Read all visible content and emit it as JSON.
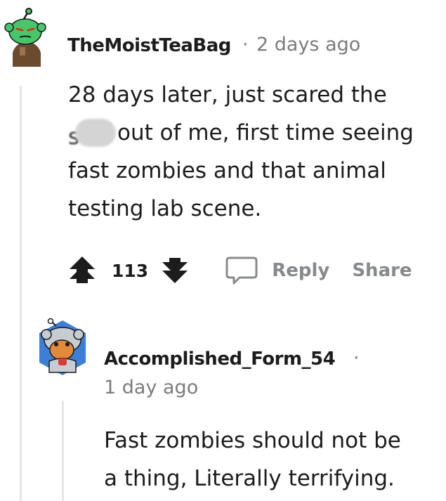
{
  "comment": {
    "username": "TheMoistTeaBag",
    "separator": "·",
    "timestamp": "2 days ago",
    "body_part1": "28 days later, just scared the",
    "redacted_visible_char": "s",
    "body_part2": "out of me, first time seeing",
    "body_line3": "fast zombies and that animal",
    "body_line4": "testing lab scene.",
    "score": "113",
    "reply_label": "Reply",
    "share_label": "Share",
    "avatar_icon": "snoo-avatar-icon",
    "upvote_icon": "upvote-arrow-icon",
    "downvote_icon": "downvote-arrow-icon",
    "comment_icon": "speech-bubble-icon"
  },
  "reply": {
    "username": "Accomplished_Form_54",
    "separator": "·",
    "timestamp": "1 day ago",
    "body_line1": "Fast zombies should not be",
    "body_line2": "a thing, Literally terrifying.",
    "avatar_icon": "snoo-avatar-icon"
  },
  "colors": {
    "text": "#1c1c1c",
    "meta": "#7c7c7c",
    "action": "#878a8c",
    "thread_line": "#e4e6e8",
    "avatar_green": "#46c86a"
  }
}
